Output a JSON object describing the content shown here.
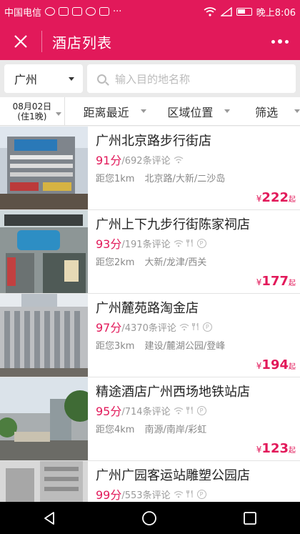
{
  "status": {
    "carrier": "中国电信",
    "dots": "···",
    "time": "晚上8:06"
  },
  "header": {
    "title": "酒店列表"
  },
  "search": {
    "city": "广州",
    "placeholder": "输入目的地名称"
  },
  "filters": {
    "date_line1": "08月02日",
    "date_line2": "(住1晚)",
    "sort": "距离最近",
    "area": "区域位置",
    "filter": "筛选"
  },
  "hotels": [
    {
      "name": "广州北京路步行街店",
      "score": "91分",
      "reviews": "/692条评论",
      "distance": "距您1km",
      "area": "北京路/大新/二沙岛",
      "price": "222",
      "icons": [
        "wifi-icon"
      ]
    },
    {
      "name": "广州上下九步行街陈家祠店",
      "score": "93分",
      "reviews": "/191条评论",
      "distance": "距您2km",
      "area": "大新/龙津/西关",
      "price": "177",
      "icons": [
        "wifi-icon",
        "dining-icon",
        "parking-icon"
      ]
    },
    {
      "name": "广州麓苑路淘金店",
      "score": "97分",
      "reviews": "/4370条评论",
      "distance": "距您3km",
      "area": "建设/麓湖公园/登峰",
      "price": "194",
      "icons": [
        "wifi-icon",
        "dining-icon",
        "parking-icon"
      ]
    },
    {
      "name": "精途酒店广州西场地铁站店",
      "score": "95分",
      "reviews": "/714条评论",
      "distance": "距您4km",
      "area": "南源/南岸/彩虹",
      "price": "123",
      "icons": [
        "wifi-icon",
        "dining-icon",
        "parking-icon"
      ]
    },
    {
      "name": "广州广园客运站雕塑公园店",
      "score": "99分",
      "reviews": "/553条评论",
      "distance": "",
      "area": "",
      "price": "",
      "icons": [
        "wifi-icon",
        "dining-icon",
        "parking-icon"
      ]
    }
  ],
  "price": {
    "currency": "¥",
    "suffix": "起"
  },
  "colors": {
    "brand": "#e2195a"
  }
}
